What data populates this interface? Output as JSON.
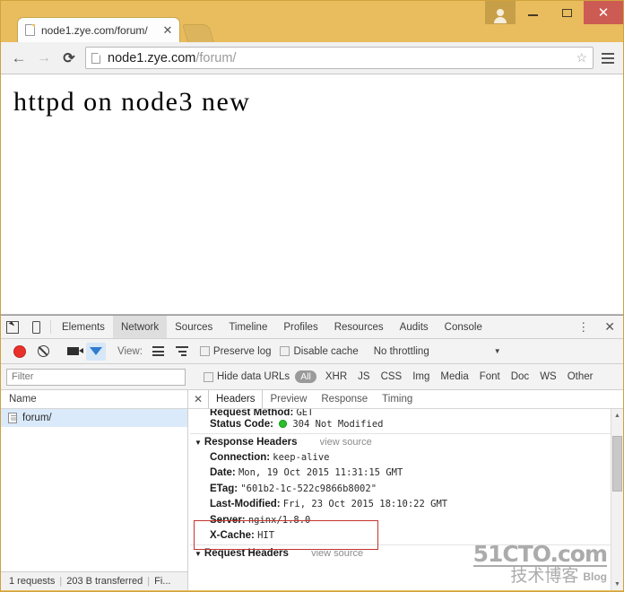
{
  "browser": {
    "window_controls": {
      "profile_icon": "person-icon",
      "minimize": "—",
      "maximize": "□",
      "close": "✕"
    },
    "tab": {
      "title": "node1.zye.com/forum/",
      "close_label": "✕",
      "favicon": "page-icon"
    },
    "toolbar": {
      "back": "←",
      "forward": "→",
      "reload": "⟳",
      "url_host": "node1.zye.com",
      "url_path": "/forum/",
      "bookmark_star": "☆",
      "menu": "hamburger-icon"
    }
  },
  "page": {
    "heading": "httpd on node3 new"
  },
  "devtools": {
    "panels": [
      "Elements",
      "Network",
      "Sources",
      "Timeline",
      "Profiles",
      "Resources",
      "Audits",
      "Console"
    ],
    "active_panel": "Network",
    "more_label": "⋮",
    "close_label": "✕",
    "controls": {
      "record": "record-icon",
      "clear": "clear-icon",
      "camera": "camera-icon",
      "filter": "filter-icon",
      "view_label": "View:",
      "preserve_log": "Preserve log",
      "disable_cache": "Disable cache",
      "throttling": "No throttling",
      "throttle_caret": "▼"
    },
    "filterbar": {
      "placeholder": "Filter",
      "value": "",
      "hide_data_urls": "Hide data URLs",
      "types": [
        "All",
        "XHR",
        "JS",
        "CSS",
        "Img",
        "Media",
        "Font",
        "Doc",
        "WS",
        "Other"
      ],
      "active_type": "All"
    },
    "requests": {
      "column_header": "Name",
      "rows": [
        {
          "name": "forum/",
          "selected": true
        }
      ]
    },
    "statusbar": {
      "requests": "1 requests",
      "transferred": "203 B transferred",
      "finish": "Fi..."
    },
    "detail": {
      "close_label": "✕",
      "tabs": [
        "Headers",
        "Preview",
        "Response",
        "Timing"
      ],
      "active_tab": "Headers",
      "general": [
        {
          "key": "Request Method:",
          "value": "GET"
        },
        {
          "key": "Status Code:",
          "value": "304 Not Modified",
          "dot": "green"
        }
      ],
      "response_headers": {
        "title": "Response Headers",
        "view_source": "view source",
        "caret": "▼",
        "items": [
          {
            "key": "Connection:",
            "value": "keep-alive"
          },
          {
            "key": "Date:",
            "value": "Mon, 19 Oct 2015 11:31:15 GMT"
          },
          {
            "key": "ETag:",
            "value": "\"601b2-1c-522c9866b8002\""
          },
          {
            "key": "Last-Modified:",
            "value": "Fri, 23 Oct 2015 18:10:22 GMT"
          },
          {
            "key": "Server:",
            "value": "nginx/1.8.0",
            "highlighted": true
          },
          {
            "key": "X-Cache:",
            "value": "HIT",
            "highlighted": true
          }
        ]
      },
      "request_headers": {
        "title": "Request Headers",
        "view_source": "view source",
        "caret": "▼"
      }
    },
    "scrollbar": {
      "up": "▲",
      "down": "▼"
    }
  },
  "watermark": {
    "line1": "51CTO.com",
    "line2": "技术博客",
    "line3": "Blog"
  },
  "colors": {
    "window_chrome": "#e9bc5e",
    "close_red": "#cc5b53",
    "selected_row": "#dbeafb",
    "highlight_box": "#c3342f",
    "status_ok": "#2bc02b",
    "filter_active": "#2f7cd0"
  }
}
